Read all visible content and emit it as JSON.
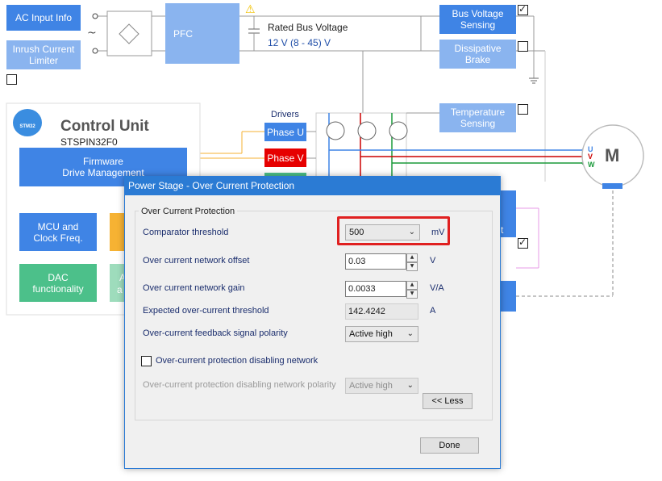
{
  "diagram": {
    "ac_input_info": "AC Input Info",
    "inrush_limiter": "Inrush Current\nLimiter",
    "pfc": "PFC",
    "rated_bus_voltage_label": "Rated Bus Voltage",
    "rated_bus_voltage_value": "12 V (8 - 45) V",
    "bus_voltage_sensing": "Bus Voltage\nSensing",
    "dissipative_brake": "Dissipative\nBrake",
    "drivers_label": "Drivers",
    "phase_u": "Phase U",
    "phase_v": "Phase V",
    "temperature_sensing": "Temperature\nSensing",
    "control_unit_title": "Control Unit",
    "control_unit_chip": "STSPIN32F0",
    "firmware": "Firmware\nDrive Management",
    "mcu_clock": "MCU and\nClock Freq.",
    "dac": "DAC\nfunctionality",
    "logo_text": "STM32",
    "motor_label": "M",
    "phase_letters": [
      "U",
      "V",
      "W"
    ],
    "partial_a1": "A",
    "partial_a2": "a",
    "partial_t": "t",
    "colors": {
      "blue": "#3f84e5",
      "light_blue": "#8ab4ef",
      "green": "#4cc08a",
      "orange": "#f6b233",
      "red": "#e60000",
      "warning": "#f2c200"
    }
  },
  "dialog": {
    "title": "Power Stage - Over Current Protection",
    "group_title": "Over Current Protection",
    "comparator_threshold": {
      "label": "Comparator threshold",
      "value": "500",
      "unit": "mV"
    },
    "network_offset": {
      "label": "Over current network offset",
      "value": "0.03",
      "unit": "V"
    },
    "network_gain": {
      "label": "Over current network gain",
      "value": "0.0033",
      "unit": "V/A"
    },
    "expected_threshold": {
      "label": "Expected over-current threshold",
      "value": "142.4242",
      "unit": "A"
    },
    "feedback_polarity": {
      "label": "Over-current feedback signal polarity",
      "value": "Active high"
    },
    "disabling_network": {
      "label": "Over-current protection disabling network",
      "checked": false
    },
    "disabling_polarity": {
      "label": "Over-current protection disabling network polarity",
      "value": "Active high"
    },
    "less_button": "<< Less",
    "done_button": "Done"
  }
}
